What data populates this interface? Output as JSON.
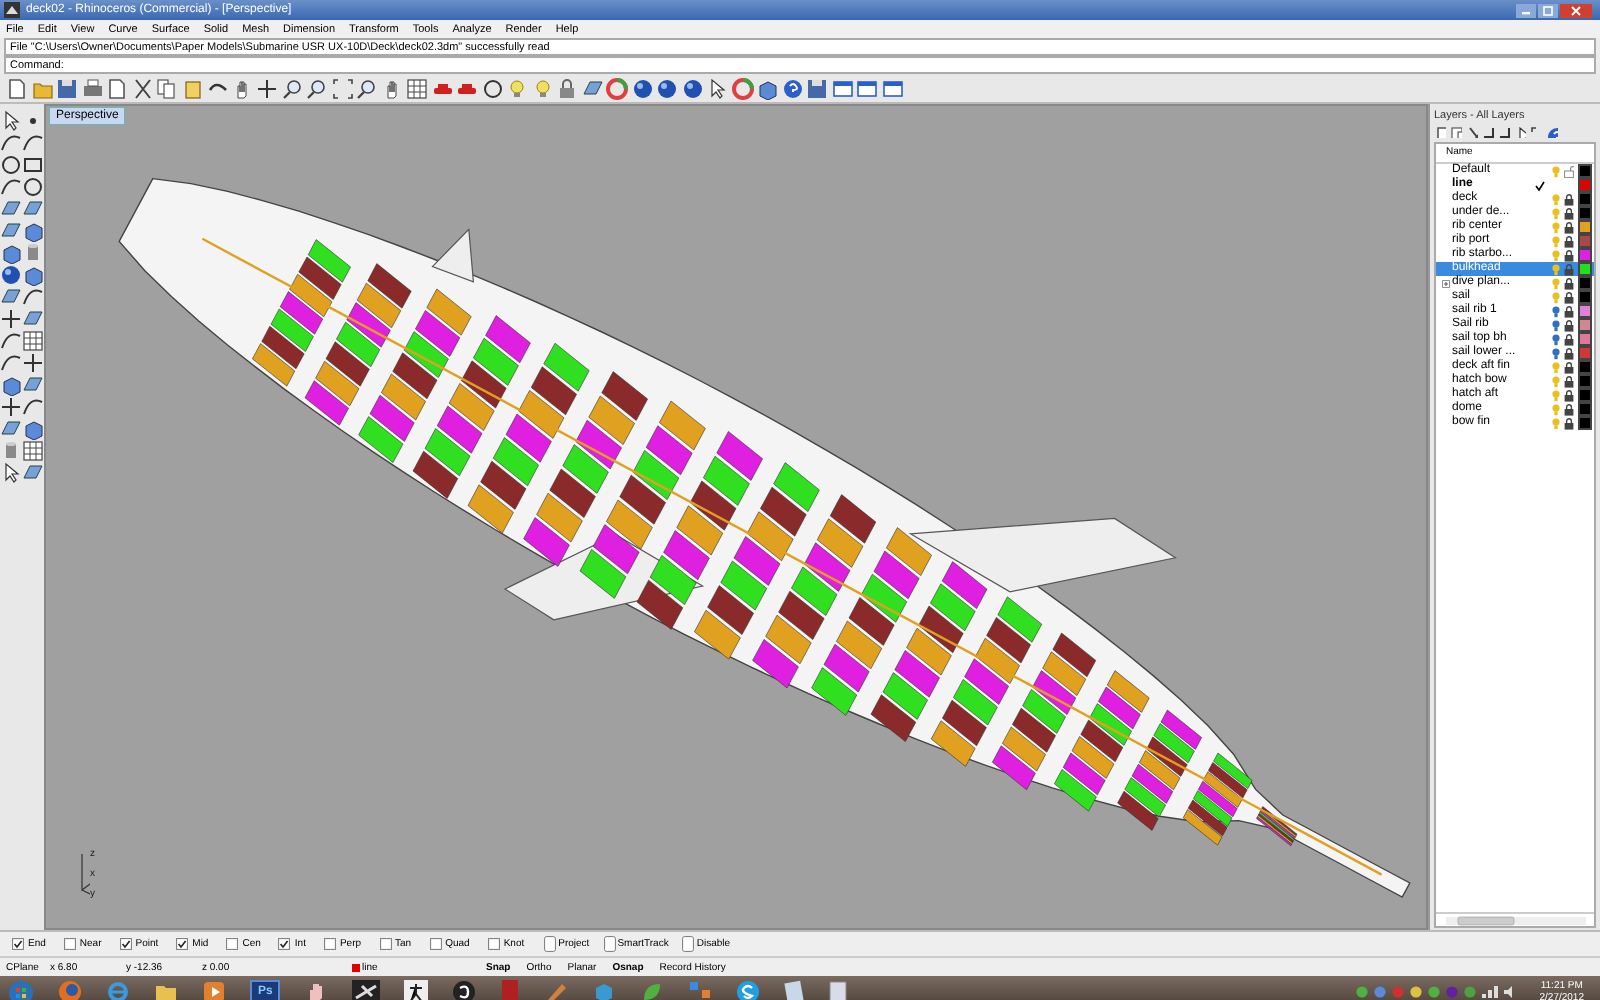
{
  "window": {
    "title": "deck02 - Rhinoceros (Commercial) - [Perspective]"
  },
  "menu": [
    "File",
    "Edit",
    "View",
    "Curve",
    "Surface",
    "Solid",
    "Mesh",
    "Dimension",
    "Transform",
    "Tools",
    "Analyze",
    "Render",
    "Help"
  ],
  "command_history": "File \"C:\\Users\\Owner\\Documents\\Paper Models\\Submarine USR UX-10D\\Deck\\deck02.3dm\" successfully read",
  "command_prompt": "Command:",
  "viewport": {
    "title": "Perspective",
    "axis_labels": [
      "z",
      "x",
      "y"
    ]
  },
  "layers_panel": {
    "title": "Layers - All Layers",
    "column": "Name",
    "layers": [
      {
        "name": "Default",
        "kind": "lit",
        "selected": false,
        "expandable": false,
        "locked": false,
        "color": "#000000"
      },
      {
        "name": "line",
        "kind": "current",
        "selected": false,
        "expandable": false,
        "color": "#e00000"
      },
      {
        "name": "deck",
        "kind": "lit",
        "selected": false,
        "expandable": false,
        "locked": true,
        "color": "#000000"
      },
      {
        "name": "under de...",
        "kind": "lit",
        "selected": false,
        "expandable": false,
        "locked": true,
        "color": "#000000"
      },
      {
        "name": "rib center",
        "kind": "lit",
        "selected": false,
        "expandable": false,
        "locked": true,
        "color": "#e0a020"
      },
      {
        "name": "rib port",
        "kind": "lit",
        "selected": false,
        "expandable": false,
        "locked": true,
        "color": "#a84848"
      },
      {
        "name": "rib starbo...",
        "kind": "lit",
        "selected": false,
        "expandable": false,
        "locked": true,
        "color": "#e020e0"
      },
      {
        "name": "bulkhead",
        "kind": "lit",
        "selected": true,
        "expandable": false,
        "locked": true,
        "color": "#20e020"
      },
      {
        "name": "dive plan...",
        "kind": "lit",
        "selected": false,
        "expandable": true,
        "locked": true,
        "color": "#000000"
      },
      {
        "name": "sail",
        "kind": "lit",
        "selected": false,
        "expandable": false,
        "locked": true,
        "color": "#000000"
      },
      {
        "name": "sail rib 1",
        "kind": "dim",
        "selected": false,
        "expandable": false,
        "locked": true,
        "color": "#e080d8"
      },
      {
        "name": "Sail rib",
        "kind": "dim",
        "selected": false,
        "expandable": false,
        "locked": true,
        "color": "#d08890"
      },
      {
        "name": "sail top bh",
        "kind": "dim",
        "selected": false,
        "expandable": false,
        "locked": true,
        "color": "#e07898"
      },
      {
        "name": "sail lower ...",
        "kind": "dim",
        "selected": false,
        "expandable": false,
        "locked": true,
        "color": "#d03838"
      },
      {
        "name": "deck aft fin",
        "kind": "lit",
        "selected": false,
        "expandable": false,
        "locked": true,
        "color": "#000000"
      },
      {
        "name": "hatch bow",
        "kind": "lit",
        "selected": false,
        "expandable": false,
        "locked": true,
        "color": "#000000"
      },
      {
        "name": "hatch aft",
        "kind": "lit",
        "selected": false,
        "expandable": false,
        "locked": true,
        "color": "#000000"
      },
      {
        "name": "dome",
        "kind": "lit",
        "selected": false,
        "expandable": false,
        "locked": true,
        "color": "#000000"
      },
      {
        "name": "bow fin",
        "kind": "lit",
        "selected": false,
        "expandable": false,
        "locked": true,
        "color": "#000000"
      }
    ]
  },
  "osnap": [
    {
      "label": "End",
      "kind": "check",
      "checked": true
    },
    {
      "label": "Near",
      "kind": "check",
      "checked": false
    },
    {
      "label": "Point",
      "kind": "check",
      "checked": true
    },
    {
      "label": "Mid",
      "kind": "check",
      "checked": true
    },
    {
      "label": "Cen",
      "kind": "check",
      "checked": false
    },
    {
      "label": "Int",
      "kind": "check",
      "checked": true
    },
    {
      "label": "Perp",
      "kind": "check",
      "checked": false
    },
    {
      "label": "Tan",
      "kind": "check",
      "checked": false
    },
    {
      "label": "Quad",
      "kind": "check",
      "checked": false
    },
    {
      "label": "Knot",
      "kind": "check",
      "checked": false
    },
    {
      "label": "Project",
      "kind": "toggle",
      "checked": false
    },
    {
      "label": "SmartTrack",
      "kind": "toggle",
      "checked": false
    },
    {
      "label": "Disable",
      "kind": "toggle",
      "checked": false
    }
  ],
  "status_bar": {
    "cplane": "CPlane",
    "x": "x 6.80",
    "y": "y -12.36",
    "z": "z 0.00",
    "layer": {
      "name": "line",
      "color": "#e00000"
    },
    "modes": [
      {
        "label": "Snap",
        "on": true
      },
      {
        "label": "Ortho",
        "on": false
      },
      {
        "label": "Planar",
        "on": false
      },
      {
        "label": "Osnap",
        "on": true
      },
      {
        "label": "Record History",
        "on": false
      }
    ]
  },
  "taskbar": {
    "photoshop_label": "Ps",
    "time": "11:21 PM",
    "date": "2/27/2012"
  }
}
